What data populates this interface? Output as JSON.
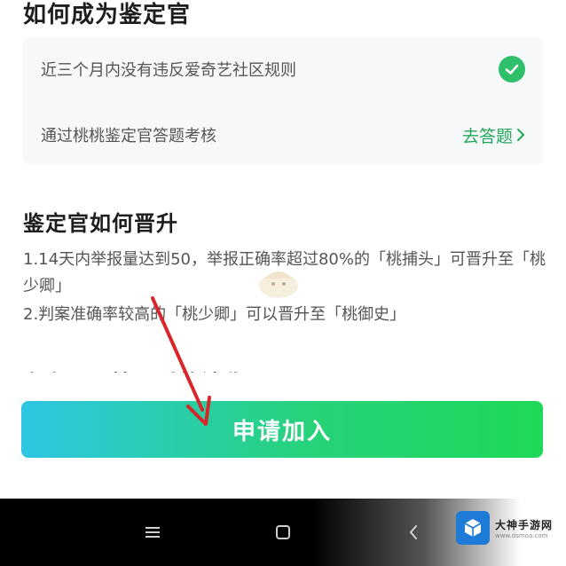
{
  "become": {
    "title": "如何成为鉴定官",
    "requirements": [
      {
        "text": "近三个月内没有违反爱奇艺社区规则"
      },
      {
        "text": "通过桃桃鉴定官答题考核",
        "action": "去答题"
      }
    ]
  },
  "promotion": {
    "title": "鉴定官如何晋升",
    "items": [
      "1.14天内举报量达到50，举报正确率超过80%的「桃捕头」可晋升至「桃少卿」",
      "2.判案准确率较高的「桃少卿」可以晋升至「桃御史」"
    ],
    "next_title_cut": "存在以下情况时将被收回"
  },
  "join_button": "申请加入",
  "colors": {
    "accent": "#22a75a",
    "check": "#2ebf6a"
  },
  "brand": {
    "name": "大神手游网",
    "url": "www.dsmoa.com"
  },
  "icons": [
    "check-icon",
    "chevron-right-icon",
    "menu-icon",
    "home-icon",
    "back-icon",
    "red-arrow-annotation",
    "brand-cube-icon"
  ]
}
